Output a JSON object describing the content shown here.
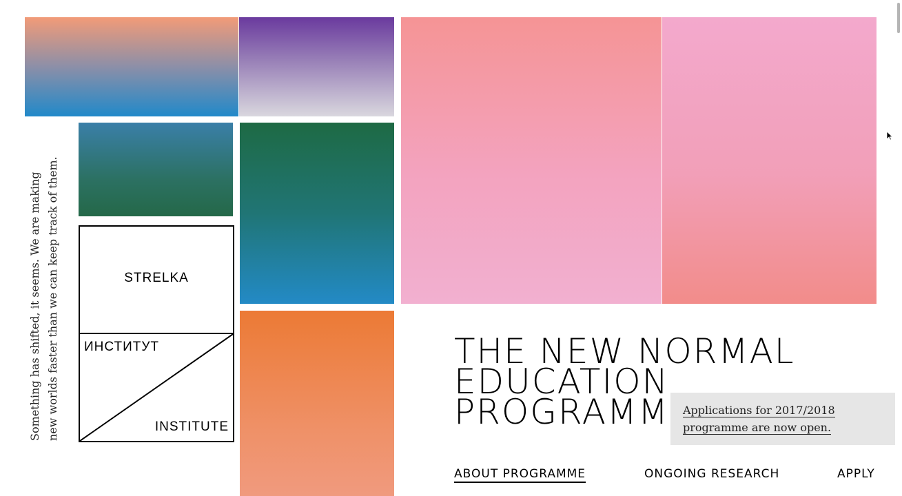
{
  "logo": {
    "word_top": "STRELKA",
    "word_middle": "ИНСТИТУТ",
    "word_bottom": "INSTITUTE"
  },
  "tagline": {
    "line1": "Something has shifted, it seems. We are making",
    "line2": "new worlds faster than we can keep track of them."
  },
  "headline": {
    "line1": "THE NEW NORMAL",
    "line2": "EDUCATION",
    "line3": "PROGRAMME"
  },
  "notice": {
    "line1": "Applications for 2017/2018",
    "line2": "programme are now open."
  },
  "nav": {
    "about": "ABOUT PROGRAMME",
    "research": "ONGOING RESEARCH",
    "apply": "APPLY"
  },
  "colors": {
    "background": "#ffffff",
    "text": "#000000",
    "notice_bg": "#e6e6e6"
  },
  "icons": {
    "cursor": "mouse-pointer-icon"
  }
}
